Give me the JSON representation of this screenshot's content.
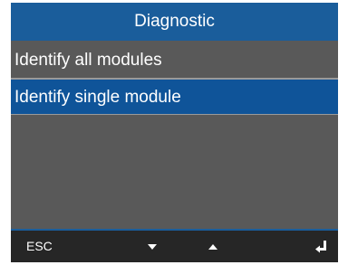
{
  "header": {
    "title": "Diagnostic"
  },
  "menu": {
    "items": [
      {
        "label": "Identify all modules",
        "selected": false
      },
      {
        "label": "Identify single module",
        "selected": true
      }
    ]
  },
  "softkeys": {
    "esc_label": "ESC",
    "down_icon": "triangle-down-icon",
    "up_icon": "triangle-up-icon",
    "enter_icon": "enter-return-icon"
  },
  "colors": {
    "header_bg": "#1a5d9b",
    "selected_bg": "#0f5499",
    "panel_bg": "#595959",
    "footer_bg": "#262626"
  }
}
